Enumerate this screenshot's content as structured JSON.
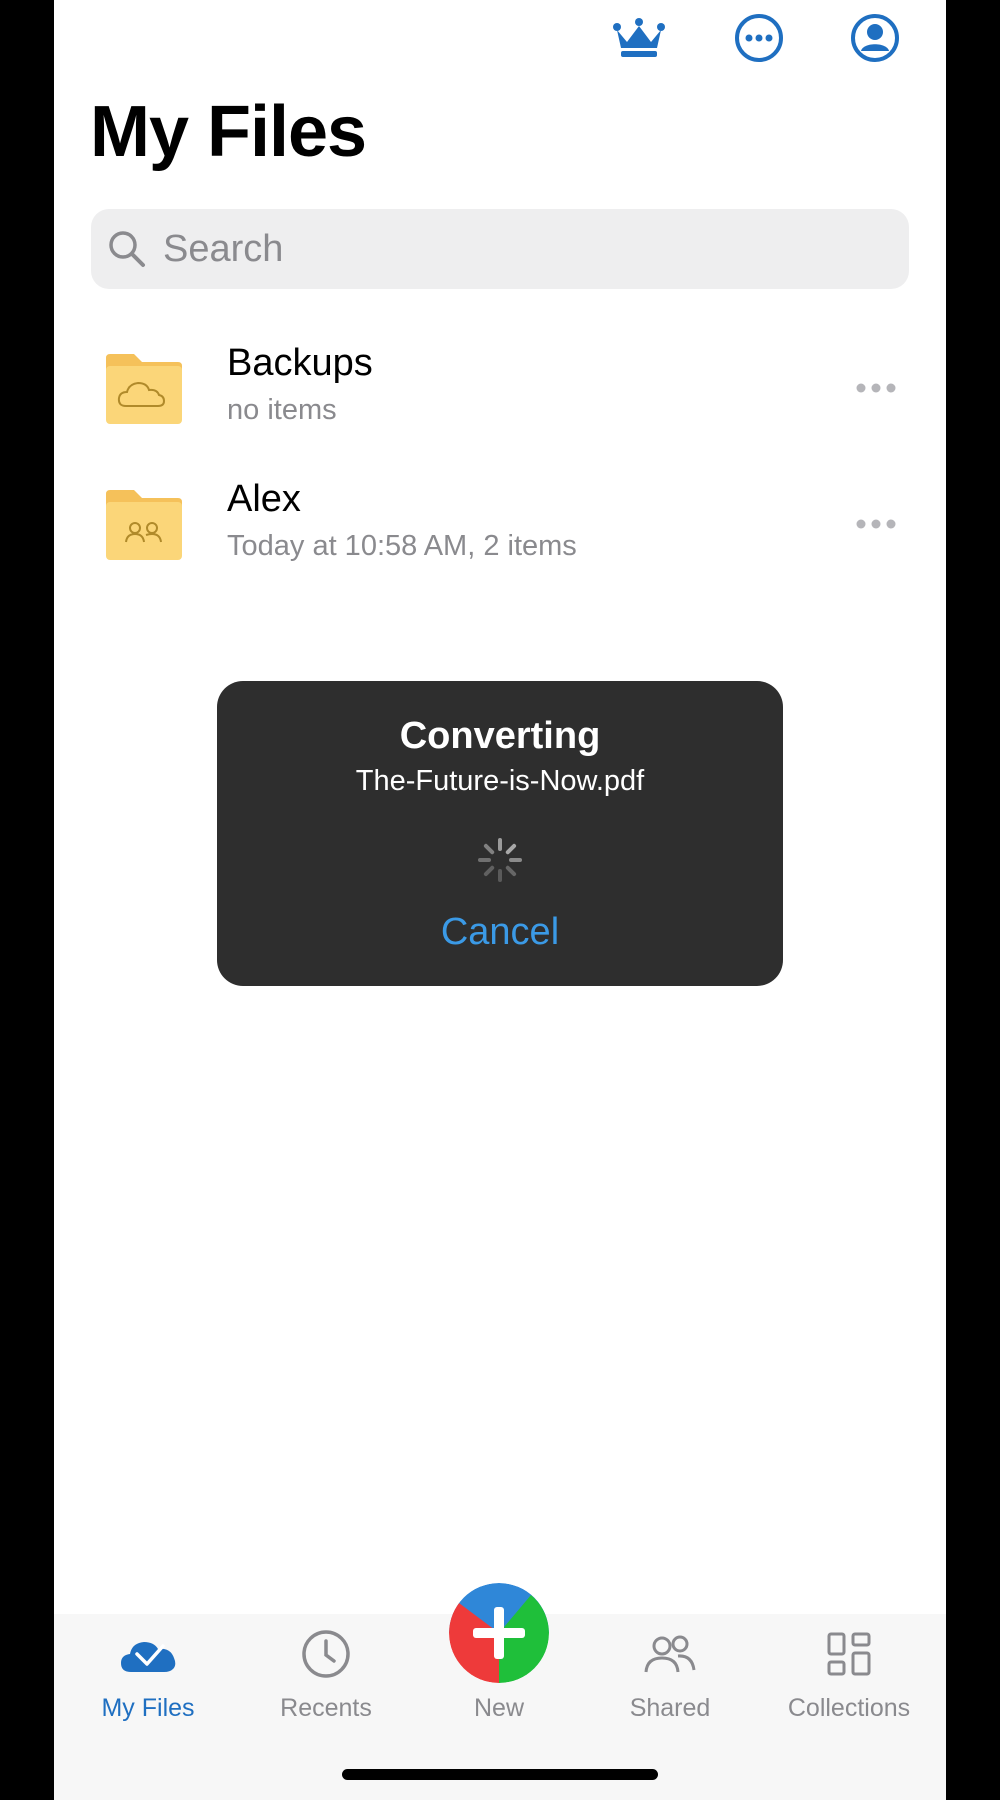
{
  "header": {
    "title": "My Files",
    "icons": [
      "crown-icon",
      "more-circle-icon",
      "account-icon"
    ]
  },
  "search": {
    "placeholder": "Search",
    "value": ""
  },
  "files": [
    {
      "name": "Backups",
      "detail": "no items",
      "icon": "cloud-folder-icon"
    },
    {
      "name": "Alex",
      "detail": "Today at 10:58 AM, 2 items",
      "icon": "shared-folder-icon"
    }
  ],
  "dialog": {
    "title": "Converting",
    "filename": "The-Future-is-Now.pdf",
    "cancel_label": "Cancel"
  },
  "tabbar": {
    "tabs": [
      {
        "label": "My Files",
        "icon": "cloud-icon",
        "active": true
      },
      {
        "label": "Recents",
        "icon": "clock-icon",
        "active": false
      },
      {
        "label": "New",
        "icon": "plus-icon",
        "active": false
      },
      {
        "label": "Shared",
        "icon": "people-icon",
        "active": false
      },
      {
        "label": "Collections",
        "icon": "grid-icon",
        "active": false
      }
    ]
  },
  "colors": {
    "accent": "#1f6fc1",
    "link": "#3b9ae6",
    "folder": "#fbd679",
    "dialog_bg": "#2e2e2e"
  }
}
